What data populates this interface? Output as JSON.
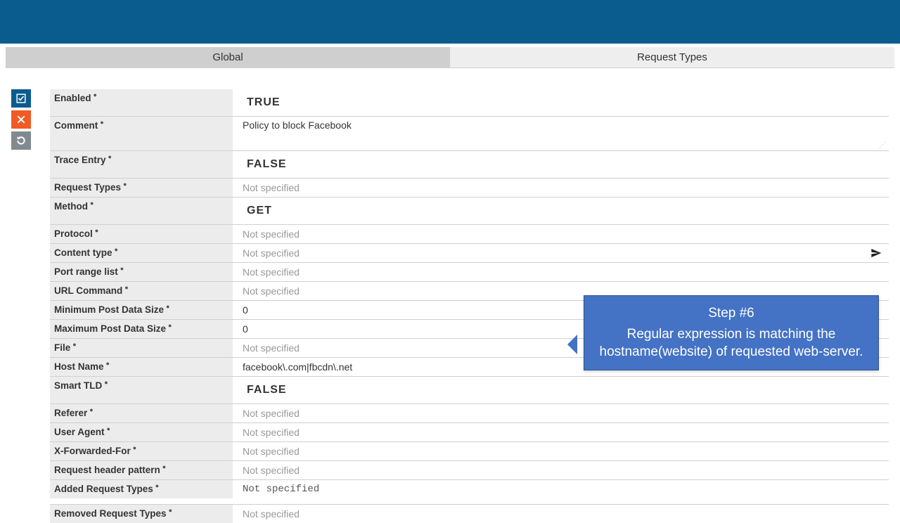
{
  "tabs": {
    "global": "Global",
    "requestTypes": "Request Types"
  },
  "sideIcons": {
    "confirm": "confirm",
    "cancel": "cancel",
    "revert": "revert"
  },
  "labels": {
    "enabled": "Enabled",
    "comment": "Comment",
    "traceEntry": "Trace Entry",
    "requestTypes": "Request Types",
    "method": "Method",
    "protocol": "Protocol",
    "contentType": "Content type",
    "portRangeList": "Port range list",
    "urlCommand": "URL Command",
    "minPost": "Minimum Post Data Size",
    "maxPost": "Maximum Post Data Size",
    "file": "File",
    "hostName": "Host Name",
    "smartTld": "Smart TLD",
    "referer": "Referer",
    "userAgent": "User Agent",
    "xff": "X-Forwarded-For",
    "reqHeaderPattern": "Request header pattern",
    "addedReqTypes": "Added Request Types",
    "removedReqTypes": "Removed Request Types"
  },
  "values": {
    "enabled": "TRUE",
    "comment": "Policy to block Facebook",
    "traceEntry": "FALSE",
    "requestTypes": "Not specified",
    "method": "GET",
    "protocol": "Not specified",
    "contentType": "Not specified",
    "portRangeList": "Not specified",
    "urlCommand": "Not specified",
    "minPost": "0",
    "maxPost": "0",
    "file": "Not specified",
    "hostName": "facebook\\.com|fbcdn\\.net",
    "smartTld": "FALSE",
    "referer": "Not specified",
    "userAgent": "Not specified",
    "xff": "Not specified",
    "reqHeaderPattern": "Not specified",
    "addedReqTypes": "Not specified",
    "removedReqTypes": "Not specified"
  },
  "callout": {
    "title": "Step #6",
    "body": "Regular expression is matching the hostname(website) of requested web-server."
  }
}
